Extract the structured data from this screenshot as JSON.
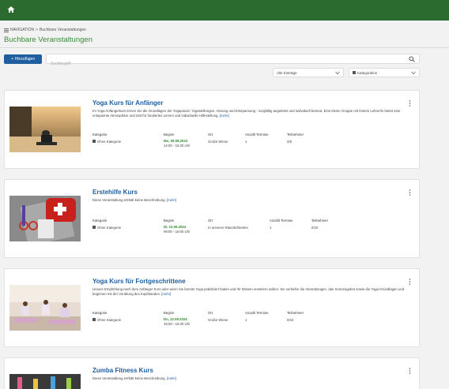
{
  "breadcrumb": {
    "nav": "NAVIGATION",
    "sep": ">",
    "current": "Buchbare Veranstaltungen"
  },
  "page_title": "Buchbare Veranstaltungen",
  "toolbar": {
    "add_label": "Hinzufügen",
    "search_placeholder": "Suchbegriff"
  },
  "filters": {
    "entries": "Alle Einträge",
    "category": "Kategorielos"
  },
  "colors": {
    "topbar": "#2b6b2f",
    "title_green": "#3a8a3a",
    "link_blue": "#1f5fa0",
    "date_green": "#2e8a2e"
  },
  "columns": {
    "kategorie": "Kategorie",
    "beginn": "Beginn",
    "ort": "Ort",
    "anzahl": "Anzahl Termine",
    "teilnehmer": "Teilnehmer"
  },
  "events": [
    {
      "title": "Yoga Kurs für Anfänger",
      "desc": "Im Yoga Anfängerkurs lernen Sie die Grundlagen der Yogapraxis: Yogastellungen, Atmung und Entspannung - sorgfältig angeleitet und individuell betreut. Eine kleine Gruppe mit festem Lehrer/in bietet eine entspannte Atmosphäre und Zeit für fundiertes Lernen und individuelle Hilfestellung.",
      "more": "[mehr]",
      "category": "Ohne Kategorie",
      "date": "Mo, 09.09.2024",
      "time": "14:00 - 15:30 Uhr",
      "place": "Große Wiese",
      "count": "1",
      "participants": "2/8"
    },
    {
      "title": "Erstehilfe Kurs",
      "desc": "Diese Veranstaltung enthält keine Beschreibung.",
      "more": "[mehr]",
      "category": "Ohne Kategorie",
      "date": "Di, 10.09.2024",
      "time": "09:00 - 16:00 Uhr",
      "place": "In unseren Räumlichkeiten",
      "count": "1",
      "participants": "0/10"
    },
    {
      "title": "Yoga Kurs für Fortgeschrittene",
      "desc": "Unsere Empfehlung nach dem Anfänger Kurs oder wenn Sie bereits Yoga praktiziert haben und Ihr Wissen erweitern wollen. Sie vertiefen die Atemübungen, das Sonnengebet sowie die Yoga-Grundlagen und beginnen mit der Vorübung des Kopfstandes.",
      "more": "[mehr]",
      "category": "Ohne Kategorie",
      "date": "Do, 12.09.2024",
      "time": "15:00 - 16:30 Uhr",
      "place": "Große Wiese",
      "count": "1",
      "participants": "0/10"
    },
    {
      "title": "Zumba Fitness Kurs",
      "desc": "Diese Veranstaltung enthält keine Beschreibung.",
      "more": "[mehr]"
    }
  ]
}
